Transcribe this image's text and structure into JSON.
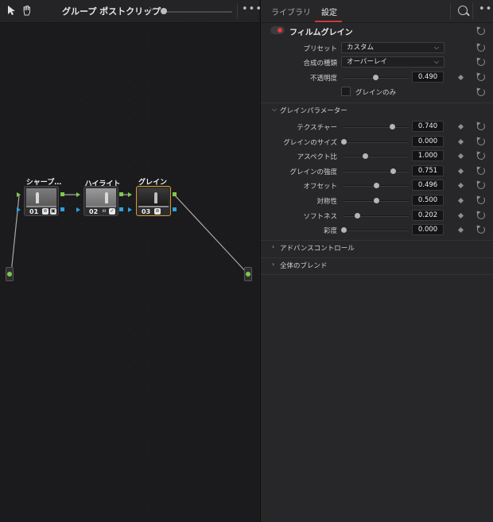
{
  "node_editor": {
    "toolbar": {
      "clip_select": "グループ ポストクリップ",
      "chevron": "⌵",
      "more": "•••"
    },
    "nodes": [
      {
        "label": "シャープ…",
        "number": "01"
      },
      {
        "label": "ハイライト",
        "number": "02"
      },
      {
        "label": "グレイン",
        "number": "03"
      }
    ]
  },
  "inspector": {
    "tabs": [
      {
        "label": "ライブラリ",
        "active": false
      },
      {
        "label": "設定",
        "active": true
      }
    ],
    "more": "•••",
    "effect": {
      "title": "フィルムグレイン",
      "enabled": true,
      "preset_label": "プリセット",
      "preset_value": "カスタム",
      "composite_label": "合成の種類",
      "composite_value": "オーバーレイ",
      "opacity_label": "不透明度",
      "opacity_value": "0.490",
      "opacity": 0.49,
      "grain_only_label": "グレインのみ",
      "grain_only_checked": false
    },
    "grain_section": {
      "title": "グレインパラメーター",
      "expanded": true,
      "params": [
        {
          "label": "テクスチャー",
          "value": "0.740",
          "level": 0.74
        },
        {
          "label": "グレインのサイズ",
          "value": "0.000",
          "level": 0.0
        },
        {
          "label": "アスペクト比",
          "value": "1.000",
          "level": 0.333
        },
        {
          "label": "グレインの強度",
          "value": "0.751",
          "level": 0.751
        },
        {
          "label": "オフセット",
          "value": "0.496",
          "level": 0.496
        },
        {
          "label": "対称性",
          "value": "0.500",
          "level": 0.5
        },
        {
          "label": "ソフトネス",
          "value": "0.202",
          "level": 0.202
        },
        {
          "label": "彩度",
          "value": "0.000",
          "level": 0.0
        }
      ]
    },
    "collapsed_sections": [
      {
        "title": "アドバンスコントロール"
      },
      {
        "title": "全体のブレンド"
      }
    ]
  },
  "colors": {
    "accent_red": "#d03a3a",
    "port_green": "#7ec94d",
    "port_blue": "#2f9fe0",
    "selected_node": "#d39b27"
  }
}
